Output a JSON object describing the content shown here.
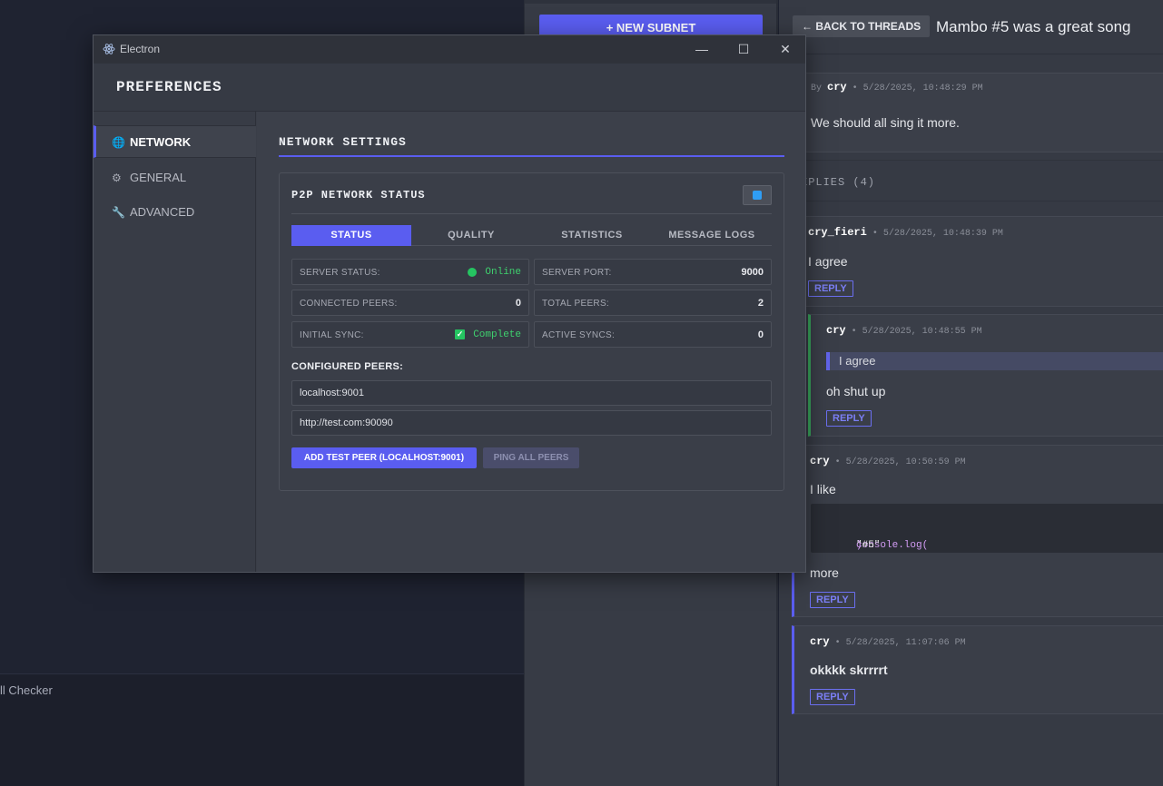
{
  "background": {
    "left_panel_text": "ll Checker",
    "new_subnet_label": "+ NEW SUBNET"
  },
  "thread": {
    "back_label": "← BACK TO THREADS",
    "title": "Mambo #5 was a great song",
    "post": {
      "by_label": "By",
      "author": "cry",
      "timestamp": "• 5/28/2025, 10:48:29 PM",
      "body": "We should all sing it more."
    },
    "replies_heading": "EPLIES (4)",
    "reply_label": "REPLY",
    "replies": [
      {
        "author": "cry_fieri",
        "timestamp": "• 5/28/2025, 10:48:39 PM",
        "text": "I agree"
      },
      {
        "author": "cry",
        "timestamp": "• 5/28/2025, 10:48:55 PM",
        "quote": "I agree",
        "text": "oh shut up"
      },
      {
        "author": "cry",
        "timestamp": "• 5/28/2025, 10:50:59 PM",
        "text": "I like",
        "code_fn": "console.log(",
        "code_str": "\"#5\"",
        "code_end": ")",
        "text2": "more"
      },
      {
        "author": "cry",
        "timestamp": "• 5/28/2025, 11:07:06 PM",
        "text": "okkkk skrrrrt"
      }
    ]
  },
  "window": {
    "app_title": "Electron",
    "minimize_glyph": "—",
    "maximize_glyph": "☐",
    "close_glyph": "✕",
    "pref_title": "PREFERENCES",
    "sidebar": [
      {
        "label": "NETWORK",
        "icon": "globe-icon",
        "glyph": "🌐"
      },
      {
        "label": "GENERAL",
        "icon": "gear-icon",
        "glyph": "⚙"
      },
      {
        "label": "ADVANCED",
        "icon": "wrench-icon",
        "glyph": "🔧"
      }
    ],
    "section_title": "NETWORK SETTINGS",
    "card_title": "P2P NETWORK STATUS",
    "tabs": [
      "STATUS",
      "QUALITY",
      "STATISTICS",
      "MESSAGE LOGS"
    ],
    "stats": {
      "server_status": {
        "label": "SERVER STATUS:",
        "value": "Online"
      },
      "server_port": {
        "label": "SERVER PORT:",
        "value": "9000"
      },
      "connected_peers": {
        "label": "CONNECTED PEERS:",
        "value": "0"
      },
      "total_peers": {
        "label": "TOTAL PEERS:",
        "value": "2"
      },
      "initial_sync": {
        "label": "INITIAL SYNC:",
        "value": "Complete"
      },
      "active_syncs": {
        "label": "ACTIVE SYNCS:",
        "value": "0"
      }
    },
    "configured_peers_label": "CONFIGURED PEERS:",
    "peers": [
      "localhost:9001",
      "http://test.com:90090"
    ],
    "add_test_peer_label": "ADD TEST PEER (LOCALHOST:9001)",
    "ping_all_label": "PING ALL PEERS"
  },
  "colors": {
    "accent": "#5a5df0",
    "status_green": "#25c461",
    "panel_bg": "#3a3e48"
  }
}
